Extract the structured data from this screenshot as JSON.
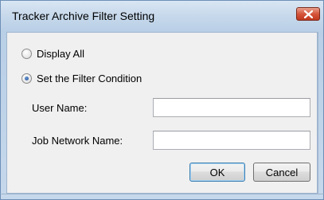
{
  "window": {
    "title": "Tracker Archive Filter Setting"
  },
  "filter_options": [
    {
      "label": "Display All",
      "selected": false
    },
    {
      "label": "Set the Filter Condition",
      "selected": true
    }
  ],
  "fields": {
    "user_name": {
      "label": "User Name:",
      "value": ""
    },
    "job_network_name": {
      "label": "Job Network Name:",
      "value": ""
    }
  },
  "buttons": {
    "ok_label": "OK",
    "cancel_label": "Cancel"
  },
  "colors": {
    "titlebar": "#c6d8eb",
    "close_button": "#d5553b",
    "client_bg": "#f0f0f0",
    "default_button_border": "#3c7fb1"
  }
}
